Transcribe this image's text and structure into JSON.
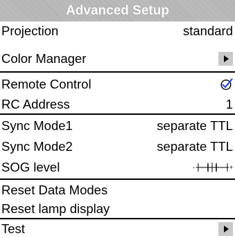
{
  "menu": {
    "title": "Advanced Setup",
    "items": [
      {
        "label": "Projection",
        "value": "standard"
      },
      {
        "label": "Color Manager",
        "icon": "submenu-arrow-icon"
      },
      {
        "label": "Remote Control",
        "icon": "checkbox-checked-icon"
      },
      {
        "label": "RC Address",
        "value": "1"
      },
      {
        "label": "Sync Mode1",
        "value": "separate TTL"
      },
      {
        "label": "Sync Mode2",
        "value": "separate TTL"
      },
      {
        "label": "SOG level",
        "icon": "slider-icon"
      },
      {
        "label": "Reset Data Modes"
      },
      {
        "label": "Reset lamp display"
      },
      {
        "label": "Test",
        "icon": "submenu-arrow-icon"
      }
    ]
  },
  "colors": {
    "title_bg": "#b4b4b4",
    "title_text": "#ffffff",
    "text": "#000000",
    "arrow_bg": "#c9c9c9",
    "check_accent": "#2a4cff"
  }
}
